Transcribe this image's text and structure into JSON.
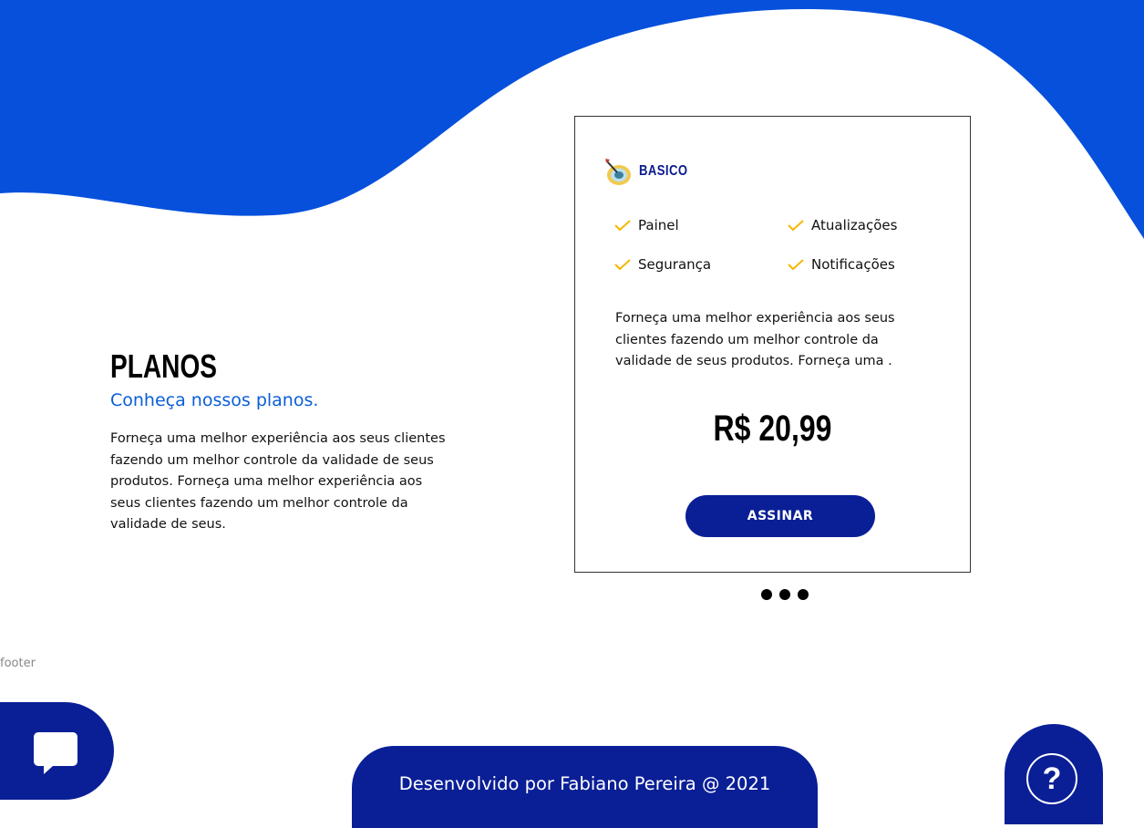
{
  "colors": {
    "accent_blue": "#0650dc",
    "navy": "#0a1f96",
    "subtitle_blue": "#0b5ed7",
    "check_yellow": "#f5b800"
  },
  "plans_section": {
    "title": "PLANOS",
    "subtitle": "Conheça nossos planos.",
    "description": "Forneça uma melhor experiência aos seus clientes fazendo um melhor controle da validade de seus produtos. Forneça uma melhor experiência aos seus clientes fazendo um melhor controle da validade de seus."
  },
  "plan_card": {
    "icon": "target-dart-icon",
    "name": "BASICO",
    "features": [
      {
        "label": "Painel",
        "icon": "check-icon"
      },
      {
        "label": "Atualizações",
        "icon": "check-icon"
      },
      {
        "label": "Segurança",
        "icon": "check-icon"
      },
      {
        "label": "Notificações",
        "icon": "check-icon"
      }
    ],
    "description": "Forneça uma melhor experiência aos seus clientes fazendo um melhor controle da validade de seus produtos. Forneça uma .",
    "price": "R$ 20,99",
    "button_label": "ASSINAR"
  },
  "carousel": {
    "dot_count": 3
  },
  "footer": {
    "label": "footer",
    "credits": "Desenvolvido por Fabiano Pereira @ 2021",
    "chat_icon": "chat-bubble-icon",
    "help_icon": "question-mark-icon",
    "help_glyph": "?"
  }
}
